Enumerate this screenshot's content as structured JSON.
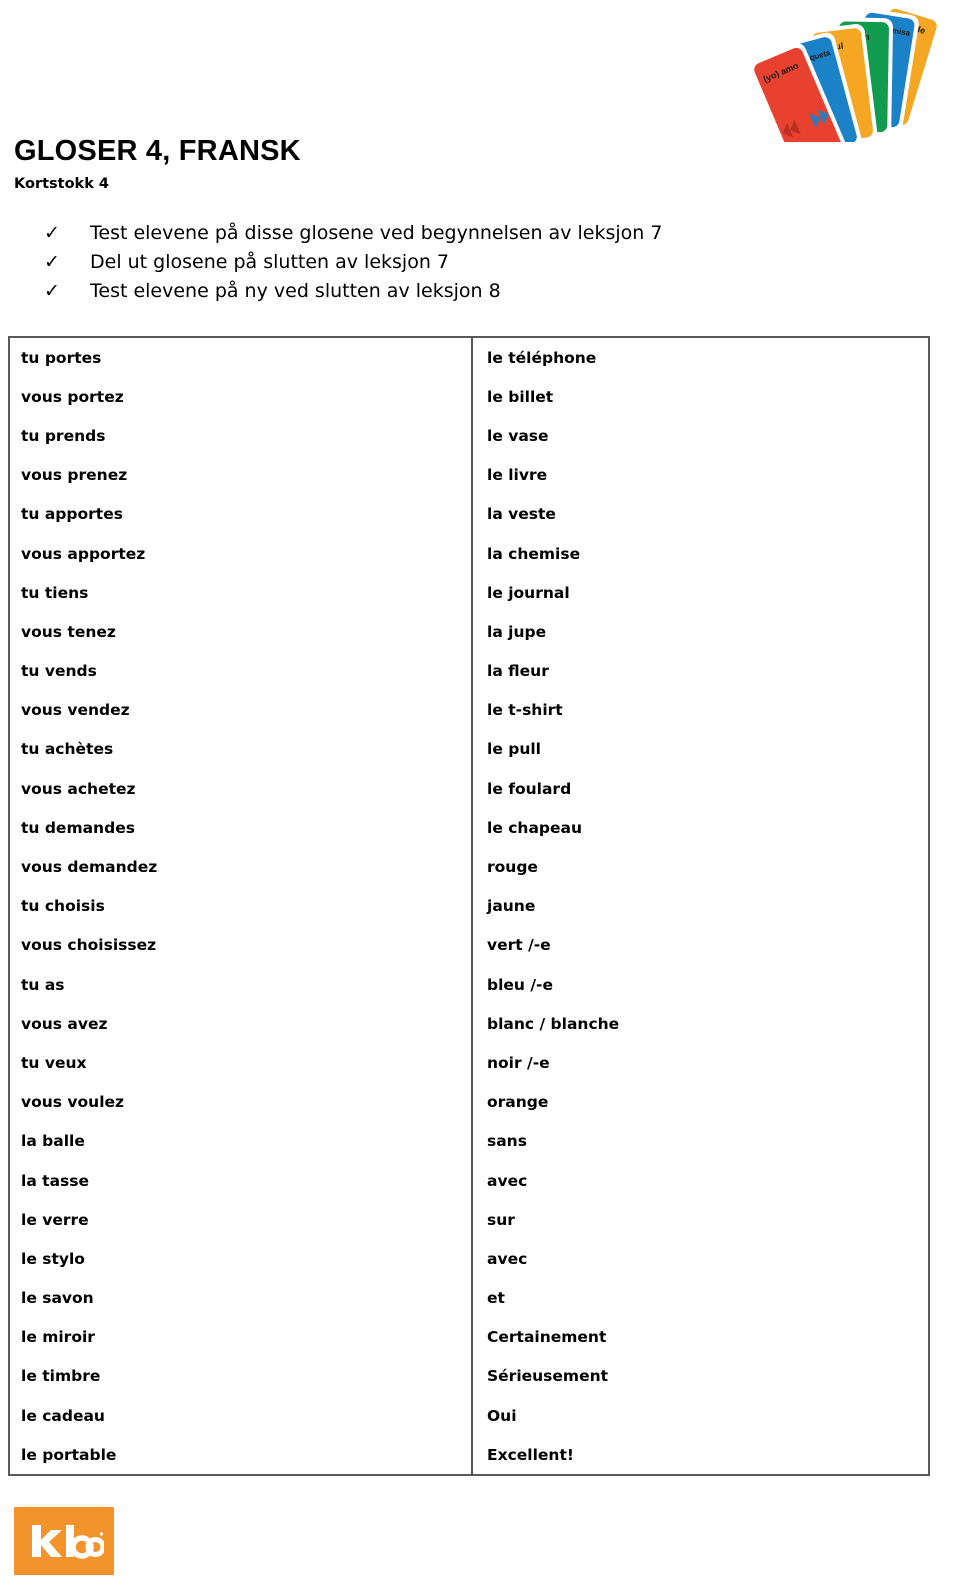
{
  "document": {
    "title": "GLOSER 4, FRANSK",
    "subtitle": "Kortstokk 4"
  },
  "instructions": {
    "bullet_glyph": "✓",
    "items": [
      "Test elevene på disse glosene ved begynnelsen av leksjon 7",
      "Del ut glosene på slutten av leksjon 7",
      "Test elevene på ny ved slutten av leksjon 8"
    ]
  },
  "glossary": {
    "rows": [
      {
        "left": "tu portes",
        "right": "le téléphone"
      },
      {
        "left": "vous portez",
        "right": "le billet"
      },
      {
        "left": "tu prends",
        "right": "le vase"
      },
      {
        "left": "vous prenez",
        "right": "le livre"
      },
      {
        "left": "tu apportes",
        "right": "la veste"
      },
      {
        "left": "vous apportez",
        "right": "la chemise"
      },
      {
        "left": "tu tiens",
        "right": "le journal"
      },
      {
        "left": "vous tenez",
        "right": "la jupe"
      },
      {
        "left": "tu vends",
        "right": "la fleur"
      },
      {
        "left": "vous vendez",
        "right": "le t-shirt"
      },
      {
        "left": "tu achètes",
        "right": "le pull"
      },
      {
        "left": "vous achetez",
        "right": "le foulard"
      },
      {
        "left": "tu demandes",
        "right": "le chapeau"
      },
      {
        "left": "vous demandez",
        "right": "rouge"
      },
      {
        "left": "tu choisis",
        "right": "jaune"
      },
      {
        "left": "vous choisissez",
        "right": "vert /-e"
      },
      {
        "left": "tu as",
        "right": "bleu /-e"
      },
      {
        "left": "vous avez",
        "right": "blanc / blanche"
      },
      {
        "left": "tu veux",
        "right": "noir /-e"
      },
      {
        "left": "vous voulez",
        "right": "orange"
      },
      {
        "left": "la balle",
        "right": "sans"
      },
      {
        "left": "la tasse",
        "right": "avec"
      },
      {
        "left": "le verre",
        "right": "sur"
      },
      {
        "left": "le stylo",
        "right": "avec"
      },
      {
        "left": "le savon",
        "right": "et"
      },
      {
        "left": "le miroir",
        "right": "Certainement"
      },
      {
        "left": "le timbre",
        "right": "Sérieusement"
      },
      {
        "left": "le cadeau",
        "right": "Oui"
      },
      {
        "left": "le portable",
        "right": "Excellent!"
      }
    ]
  },
  "card_fan": {
    "cards": [
      {
        "label": "grande",
        "color": "#F5A623"
      },
      {
        "label": "una camisa",
        "color": "#1B82C8"
      },
      {
        "label": "Con",
        "color": "#109B4E"
      },
      {
        "label": "azul",
        "color": "#F5A623"
      },
      {
        "label": "la chaqueta",
        "color": "#1B82C8"
      },
      {
        "label": "(yo) amo",
        "color": "#E8412F"
      }
    ]
  },
  "footer": {
    "logo_text": "kloo",
    "logo_color": "#F2942B"
  }
}
